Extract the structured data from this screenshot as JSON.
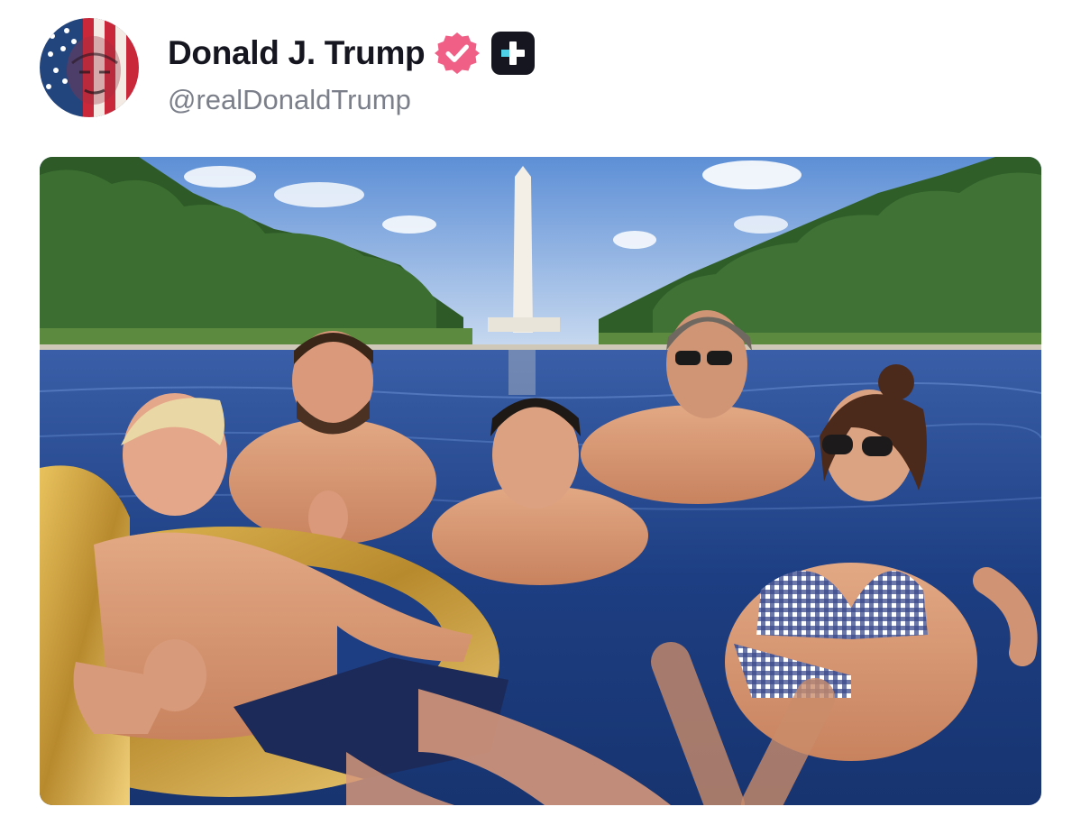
{
  "post": {
    "author": {
      "display_name": "Donald J. Trump",
      "handle": "@realDonaldTrump",
      "avatar_icon": "flag-portrait-avatar",
      "verified_icon": "verified-check-badge-icon",
      "plus_icon": "plus-badge-icon"
    },
    "media": {
      "type": "photo"
    }
  },
  "colors": {
    "name_text": "#15161f",
    "handle_text": "#7b7f8a",
    "verified_badge": "#ef5f86",
    "plus_badge": "#15161f",
    "plus_badge_accent": "#4fd1e8",
    "background": "#ffffff"
  }
}
